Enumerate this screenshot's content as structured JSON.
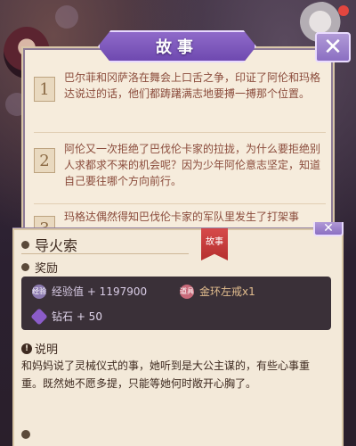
{
  "story": {
    "title": "故事",
    "entries": [
      {
        "num": "1",
        "text": "巴尔菲和冈萨洛在舞会上口舌之争，印证了阿伦和玛格达说过的话，他们都踌躇满志地要搏一搏那个位置。"
      },
      {
        "num": "2",
        "text": "阿伦又一次拒绝了巴伐伦卡家的拉拢，为什么要拒绝别人求都求不来的机会呢？因为少年阿伦意志坚定，知道自己要往哪个方向前行。"
      },
      {
        "num": "3",
        "text": "玛格达偶然得知巴伐伦卡家的军队里发生了打架事"
      }
    ]
  },
  "detail": {
    "ribbon": "故事",
    "title": "导火索",
    "reward_label": "奖励",
    "rewards": [
      {
        "icon": "exp-icon",
        "icon_text": "经验",
        "label": "经验值 + 1197900",
        "color": "#c9b9d6",
        "icon_color": "#8c7ab0"
      },
      {
        "icon": "ring-icon",
        "icon_text": "道具",
        "label": "金环左戒x1",
        "color": "#d9b58a",
        "icon_color": "#c86a7a"
      },
      {
        "icon": "diamond-icon",
        "icon_text": "",
        "label": "钻石 + 50",
        "color": "#d7c9e3",
        "icon_color": "#8b5cc9"
      }
    ],
    "desc_label": "说明",
    "desc_text": "和妈妈说了灵械仪式的事，她听到是大公主谋的，有些心事重重。既然她不愿多提，只能等她何时敞开心胸了。"
  }
}
